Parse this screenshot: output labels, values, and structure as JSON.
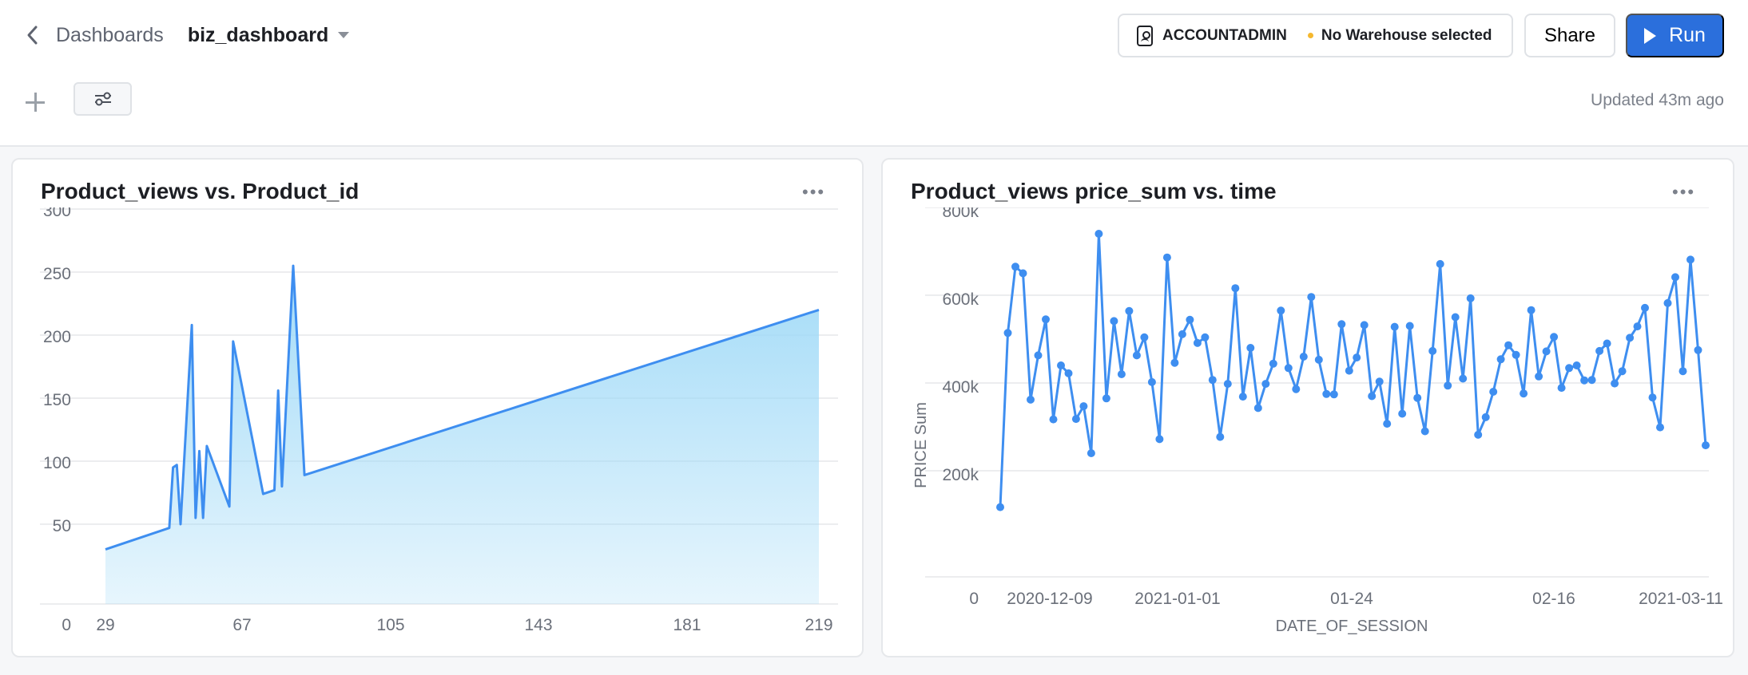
{
  "header": {
    "breadcrumb_parent": "Dashboards",
    "dashboard_title": "biz_dashboard",
    "role": "ACCOUNTADMIN",
    "warehouse_status": "No Warehouse selected",
    "share_label": "Share",
    "run_label": "Run",
    "updated_text": "Updated 43m ago"
  },
  "colors": {
    "accent": "#2b6fdc",
    "series": "#3e8ef0",
    "area_fill": "#9ed9f7",
    "warehouse_dot": "#f5b82e"
  },
  "icons": [
    "chevron-left-icon",
    "caret-down-icon",
    "role-icon",
    "play-icon",
    "plus-icon",
    "sliders-icon",
    "more-icon"
  ],
  "chart_data": [
    {
      "type": "area",
      "title": "Product_views vs. Product_id",
      "xlabel": "",
      "ylabel": "",
      "xlim": [
        26,
        219
      ],
      "ylim": [
        0,
        300
      ],
      "x_ticks": [
        "29",
        "67",
        "105",
        "143",
        "181",
        "219"
      ],
      "y_ticks": [
        "0",
        "50",
        "100",
        "150",
        "200",
        "250",
        "300"
      ],
      "x": [
        29,
        46,
        47,
        48,
        49,
        52,
        53,
        54,
        55,
        56,
        62,
        63,
        71,
        74,
        75,
        76,
        79,
        82,
        219
      ],
      "y": [
        30,
        47,
        95,
        97,
        50,
        208,
        55,
        108,
        55,
        112,
        64,
        195,
        74,
        77,
        156,
        80,
        255,
        89,
        220
      ],
      "grid": true
    },
    {
      "type": "line",
      "title": "Product_views price_sum vs. time",
      "xlabel": "DATE_OF_SESSION",
      "ylabel": "PRICE Sum",
      "ylim": [
        0,
        800000
      ],
      "x_tick_labels": [
        "2020-12-09",
        "2021-01-01",
        "01-24",
        "02-16",
        "2021-03-11"
      ],
      "y_ticks": [
        "0",
        "200k",
        "400k",
        "600k",
        "800k"
      ],
      "values": [
        137000,
        534000,
        685000,
        670000,
        382000,
        483000,
        565000,
        337000,
        460000,
        442000,
        338000,
        367000,
        260000,
        760000,
        385000,
        561000,
        440000,
        584000,
        483000,
        524000,
        422000,
        292000,
        706000,
        466000,
        531000,
        564000,
        511000,
        524000,
        427000,
        297000,
        418000,
        636000,
        389000,
        500000,
        363000,
        418000,
        464000,
        585000,
        454000,
        406000,
        480000,
        616000,
        473000,
        395000,
        394000,
        554000,
        448000,
        478000,
        552000,
        390000,
        423000,
        327000,
        548000,
        350000,
        550000,
        386000,
        310000,
        493000,
        691000,
        414000,
        570000,
        430000,
        613000,
        302000,
        342000,
        400000,
        474000,
        506000,
        484000,
        396000,
        586000,
        435000,
        492000,
        525000,
        409000,
        454000,
        460000,
        426000,
        427000,
        493000,
        510000,
        419000,
        447000,
        523000,
        549000,
        591000,
        387000,
        319000,
        602000,
        661000,
        447000,
        701000,
        495000,
        278000
      ],
      "grid": true
    }
  ]
}
